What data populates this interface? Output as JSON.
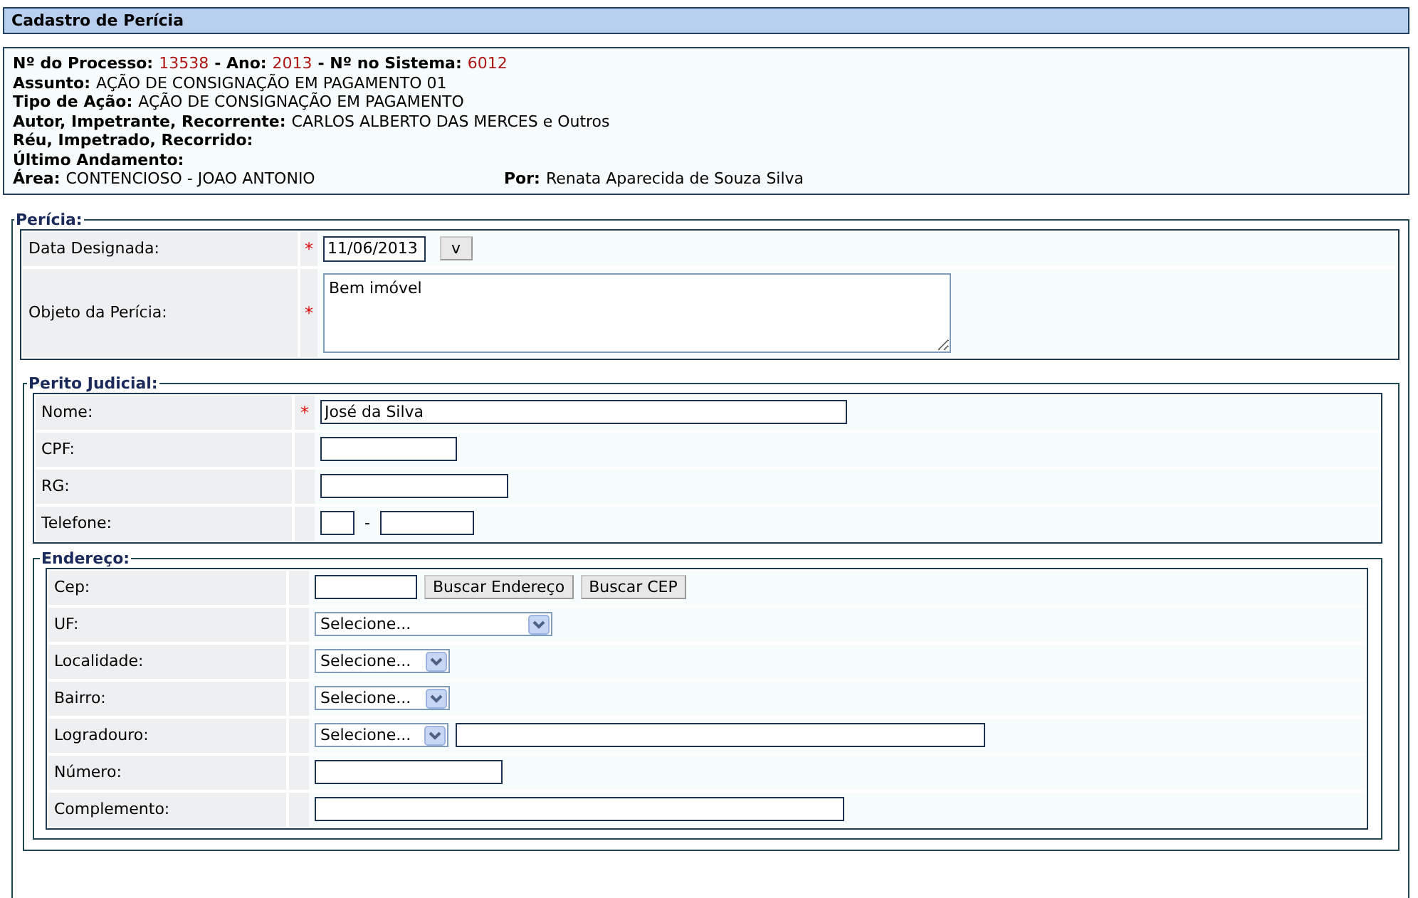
{
  "title": "Cadastro de Perícia",
  "info": {
    "lines": [
      [
        {
          "label": "Nº do Processo:",
          "value": "13538",
          "kind": "number"
        },
        {
          "label": "- Ano:",
          "value": "2013",
          "kind": "number"
        },
        {
          "label": "- Nº no Sistema:",
          "value": "6012",
          "kind": "number"
        }
      ],
      [
        {
          "label": "Assunto:",
          "value": "AÇÃO DE CONSIGNAÇÃO EM PAGAMENTO 01",
          "kind": "text"
        }
      ],
      [
        {
          "label": "Tipo de Ação:",
          "value": "AÇÃO DE CONSIGNAÇÃO EM PAGAMENTO",
          "kind": "text"
        }
      ],
      [
        {
          "label": "Autor, Impetrante, Recorrente:",
          "value": "CARLOS ALBERTO DAS MERCES e Outros",
          "kind": "text"
        }
      ],
      [
        {
          "label": "Réu, Impetrado, Recorrido:"
        }
      ],
      [
        {
          "label": "Último Andamento:"
        }
      ]
    ],
    "footer": [
      {
        "label": "Área:",
        "value": "CONTENCIOSO - JOAO ANTONIO"
      },
      {
        "label": "Por:",
        "value": "Renata Aparecida de Souza Silva"
      }
    ]
  },
  "pericia": {
    "legend": "Perícia:",
    "rows": [
      {
        "label": "Data Designada:",
        "required_mark": "*",
        "kind": "date",
        "value": "11/06/2013",
        "button": "v"
      },
      {
        "label": "Objeto da Perícia:",
        "required_mark": "*",
        "kind": "textarea",
        "value": "Bem imóvel"
      }
    ]
  },
  "perito": {
    "legend": "Perito Judicial:",
    "rows": [
      {
        "label": "Nome:",
        "required_mark": "*",
        "kind": "text",
        "value": "José da Silva"
      },
      {
        "label": "CPF:",
        "kind": "text"
      },
      {
        "label": "RG:",
        "kind": "text"
      },
      {
        "label": "Telefone:",
        "kind": "phone",
        "separator": "-"
      }
    ],
    "endereco": {
      "legend": "Endereço:",
      "rows": [
        {
          "label": "Cep:",
          "kind": "cep",
          "buttons": [
            "Buscar Endereço",
            "Buscar CEP"
          ]
        },
        {
          "label": "UF:",
          "kind": "select",
          "value": "Selecione..."
        },
        {
          "label": "Localidade:",
          "kind": "select",
          "value": "Selecione..."
        },
        {
          "label": "Bairro:",
          "kind": "select",
          "value": "Selecione..."
        },
        {
          "label": "Logradouro:",
          "kind": "select_text",
          "value": "Selecione..."
        },
        {
          "label": "Número:",
          "kind": "text"
        },
        {
          "label": "Complemento:",
          "kind": "text"
        }
      ]
    }
  }
}
